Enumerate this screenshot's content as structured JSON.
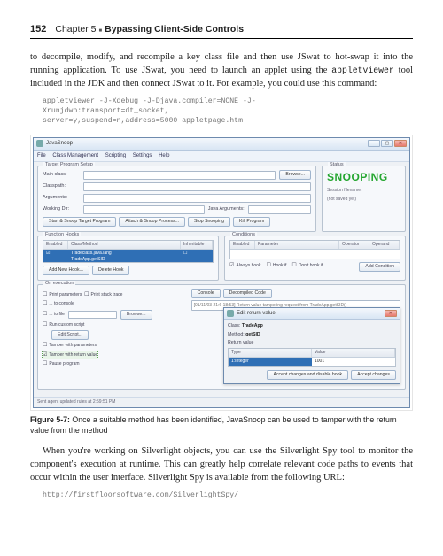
{
  "header": {
    "page": "152",
    "chapter_label": "Chapter 5",
    "chapter_title": "Bypassing Client-Side Controls"
  },
  "p1": "to decompile, modify, and recompile a key class file and then use JSwat to hot-swap it into the running application. To use JSwat, you need to launch an applet using the appletviewer tool included in the JDK and then connect JSwat to it. For example, you could use this command:",
  "command": {
    "l1": "appletviewer -J-Xdebug -J-Djava.compiler=NONE -J-",
    "l2": "Xrunjdwp:transport=dt_socket,",
    "l3": "server=y,suspend=n,address=5000 appletpage.htm"
  },
  "win": {
    "title": "JavaSnoop",
    "menu": {
      "file": "File",
      "cls": "Class Management",
      "scr": "Scripting",
      "set": "Settings",
      "help": "Help"
    },
    "tgt": {
      "legend": "Target Program Setup",
      "main": "Main class:",
      "cp": "Classpath:",
      "args": "Arguments:",
      "wd": "Working Dir:",
      "jargs": "Java Arguments:",
      "browse": "Browse...",
      "b1": "Start & Snoop Target Program",
      "b2": "Attach & Snoop Process...",
      "b3": "Stop Snooping",
      "b4": "Kill Program"
    },
    "status": {
      "legend": "Status",
      "txt": "SNOOPING",
      "sub1": "Session filename:",
      "sub2": "(not saved yet)"
    },
    "hooks": {
      "legend": "Function Hooks",
      "c1": "Enabled",
      "c2": "Class/Method",
      "c3": "Inheritable",
      "rowcls": "Tradeclass.java.lang",
      "rowmtd": "TradeApp.getSID",
      "add": "Add New Hook...",
      "del": "Delete Hook"
    },
    "cond": {
      "legend": "Conditions",
      "c1": "Enabled",
      "c2": "Parameter",
      "c3": "Operator",
      "c4": "Operand",
      "always": "Always hook",
      "ifcond": "Hook if",
      "dont": "Don't hook if",
      "addc": "Add Condition"
    },
    "exec": {
      "legend": "On execution",
      "pparams": "Print parameters",
      "pstack": "Print stack trace",
      "toconsole": "... to console",
      "tofile": "... to file",
      "browse": "Browse...",
      "runscript": "Run custom script",
      "editscript": "Edit Script...",
      "tparams": "Tamper with parameters",
      "tret": "Tamper with return value",
      "pause": "Pause program",
      "tab1": "Console",
      "tab2": "Decompiled Code",
      "log": "[01/11/03 21:6 18:53] Return value tampering request from TradeApp.getSID()"
    },
    "statusbar": "Sent agent updated rules at 2:59:51 PM"
  },
  "dlg": {
    "title": "Edit return value",
    "cls_l": "Class:",
    "cls_v": "TradeApp",
    "mtd_l": "Method:",
    "mtd_v": "getSID",
    "rv": "Return value",
    "th1": "Type",
    "th2": "Value",
    "type": "1:Integer",
    "value": "1001",
    "b1": "Accept changes and disable hook",
    "b2": "Accept changes"
  },
  "caption": {
    "label": "Figure 5-7:",
    "text": " Once a suitable method has been identified, JavaSnoop can be used to tamper with the return value from the method"
  },
  "p2": "When you're working on Silverlight objects, you can use the Silverlight Spy tool to monitor the component's execution at runtime. This can greatly help correlate relevant code paths to events that occur within the user interface. Silverlight Spy is available from the following URL:",
  "url": "http://firstfloorsoftware.com/SilverlightSpy/"
}
